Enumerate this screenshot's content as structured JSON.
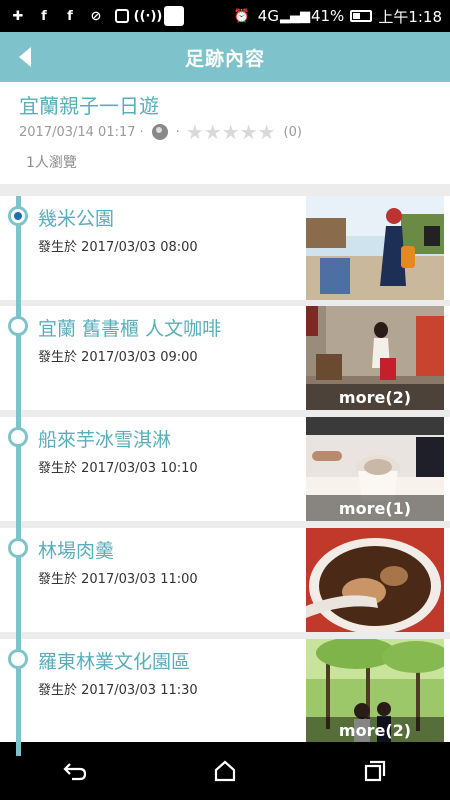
{
  "status_bar": {
    "battery": "41%",
    "time": "上午1:18",
    "network": "4G"
  },
  "app_bar": {
    "title": "足跡內容"
  },
  "trip": {
    "title": "宜蘭親子一日遊",
    "date": "2017/03/14 01:17",
    "separator": "·",
    "rating": 0,
    "rating_count": "(0)",
    "views": "1人瀏覽"
  },
  "entries": [
    {
      "title": "幾米公園",
      "time": "發生於 2017/03/03  08:00",
      "more": ""
    },
    {
      "title": "宜蘭 舊書櫃 人文咖啡",
      "time": "發生於 2017/03/03  09:00",
      "more": "more(2)"
    },
    {
      "title": "船來芋冰雪淇淋",
      "time": "發生於 2017/03/03  10:10",
      "more": "more(1)"
    },
    {
      "title": "林場肉羹",
      "time": "發生於 2017/03/03  11:00",
      "more": ""
    },
    {
      "title": "羅東林業文化園區",
      "time": "發生於 2017/03/03  11:30",
      "more": "more(2)"
    }
  ],
  "colors": {
    "accent": "#7ec3cc",
    "title_text": "#5aaebb"
  }
}
